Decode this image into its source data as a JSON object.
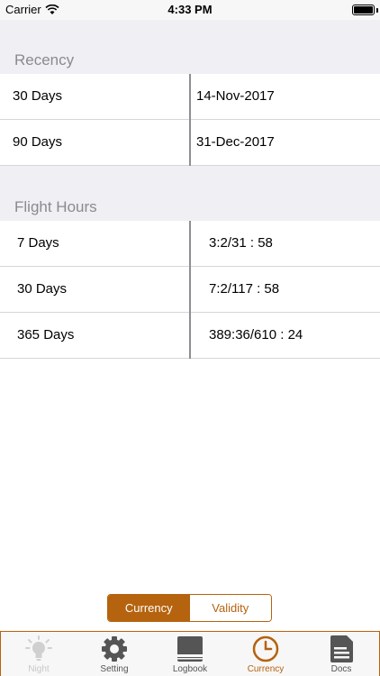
{
  "status_bar": {
    "carrier": "Carrier",
    "time": "4:33 PM"
  },
  "recency": {
    "header": "Recency",
    "rows": [
      {
        "period": "30 Days",
        "value": "14-Nov-2017"
      },
      {
        "period": "90 Days",
        "value": "31-Dec-2017"
      }
    ]
  },
  "flight_hours": {
    "header": "Flight Hours",
    "rows": [
      {
        "period": "7 Days",
        "value": "3:2/31 : 58"
      },
      {
        "period": "30 Days",
        "value": "7:2/117 : 58"
      },
      {
        "period": "365 Days",
        "value": "389:36/610 : 24"
      }
    ]
  },
  "segment": {
    "currency_label": "Currency",
    "validity_label": "Validity",
    "selected": "Currency"
  },
  "tabbar": {
    "tabs": [
      {
        "label": "Night",
        "icon": "lightbulb-icon"
      },
      {
        "label": "Setting",
        "icon": "gear-icon"
      },
      {
        "label": "Logbook",
        "icon": "book-icon"
      },
      {
        "label": "Currency",
        "icon": "clock-icon"
      },
      {
        "label": "Docs",
        "icon": "document-icon"
      }
    ],
    "selected": "Currency"
  },
  "colors": {
    "accent": "#b5630e",
    "tab_inactive": "#555555",
    "tab_disabled": "#c8c8c8",
    "section_bg": "#efeff4"
  }
}
